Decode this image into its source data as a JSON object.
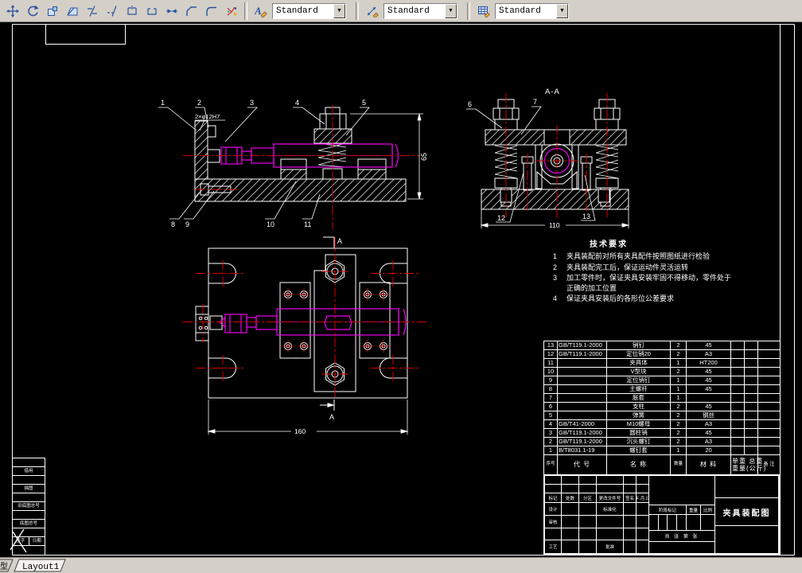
{
  "toolbar": {
    "style_controls": [
      {
        "name": "text-style",
        "value": "Standard"
      },
      {
        "name": "dim-style",
        "value": "Standard"
      },
      {
        "name": "table-style",
        "value": "Standard"
      }
    ]
  },
  "tabs": {
    "model_partial": "型",
    "layout": "Layout1"
  },
  "views": {
    "front": {
      "balloons_top": [
        "1",
        "2",
        "3",
        "4",
        "5"
      ],
      "balloons_bottom": [
        "8",
        "9",
        "10",
        "11"
      ],
      "dim_height": "65",
      "dim_holes": "2×φ12H7"
    },
    "section": {
      "label": "A-A",
      "balloons_top": [
        "6",
        "7"
      ],
      "balloons_bottom": [
        "12",
        "13"
      ],
      "dim_width": "110"
    },
    "plan": {
      "section_letter_top": "A",
      "section_letter_bottom": "A",
      "dim_width": "160"
    }
  },
  "tech_requirements": {
    "title": "技术要求",
    "items": [
      {
        "no": "1",
        "text": "夹具装配前对所有夹具配件按照图纸进行检验"
      },
      {
        "no": "2",
        "text": "夹具装配完工后，保证运动件灵活运转"
      },
      {
        "no": "3",
        "text": "加工零件时，保证夹具安装牢固不得移动，零件处于正确的加工位置"
      },
      {
        "no": "4",
        "text": "保证夹具安装后的各形位公差要求"
      }
    ]
  },
  "bom": {
    "headers": {
      "no": "序号",
      "code": "代  号",
      "name": "名  称",
      "qty": "数量",
      "material": "材  料",
      "weight_top": "单重 总重",
      "weight_bottom": "重量(公斤)",
      "remark": "备 注"
    },
    "rows": [
      {
        "no": "13",
        "code": "GB/T119.1-2000",
        "name": "销钉",
        "qty": "2",
        "material": "45"
      },
      {
        "no": "12",
        "code": "GB/T119.1-2000",
        "name": "定位销20",
        "qty": "2",
        "material": "A3"
      },
      {
        "no": "11",
        "code": "",
        "name": "夹具体",
        "qty": "1",
        "material": "HT200"
      },
      {
        "no": "10",
        "code": "",
        "name": "V型块",
        "qty": "2",
        "material": "45"
      },
      {
        "no": "9",
        "code": "",
        "name": "定位销钉",
        "qty": "1",
        "material": "45"
      },
      {
        "no": "8",
        "code": "",
        "name": "主螺杆",
        "qty": "1",
        "material": "45"
      },
      {
        "no": "7",
        "code": "",
        "name": "胀套",
        "qty": "1",
        "material": "45"
      },
      {
        "no": "6",
        "code": "",
        "name": "支柱",
        "qty": "2",
        "material": "45"
      },
      {
        "no": "5",
        "code": "",
        "name": "弹簧",
        "qty": "2",
        "material": "钢丝"
      },
      {
        "no": "4",
        "code": "GB/T41-2000",
        "name": "M10螺母",
        "qty": "2",
        "material": "A3"
      },
      {
        "no": "3",
        "code": "GB/T119.1-2000",
        "name": "圆柱销",
        "qty": "2",
        "material": "45"
      },
      {
        "no": "2",
        "code": "GB/T119.1-2000",
        "name": "沉头螺钉",
        "qty": "2",
        "material": "A3"
      },
      {
        "no": "1",
        "code": "B/T8031.1-19",
        "name": "螺钉套",
        "qty": "1",
        "material": "20"
      }
    ]
  },
  "title_block": {
    "title": "夹具装配图",
    "row_labels": [
      "标记",
      "处数",
      "分区",
      "更改文件号",
      "签名",
      "年.月.日"
    ],
    "left_labels": {
      "design": "设计",
      "check": "审核",
      "process": "工艺",
      "standard": "标准化",
      "approve": "批准"
    },
    "mid_labels": {
      "stage": "阶段标记",
      "weight": "重量",
      "scale": "比例"
    },
    "sheet": "共 张 第 张"
  },
  "left_strip": {
    "labels": [
      "借用",
      "描图",
      "旧底图总号",
      "底图总号",
      "签字",
      "日期"
    ]
  }
}
